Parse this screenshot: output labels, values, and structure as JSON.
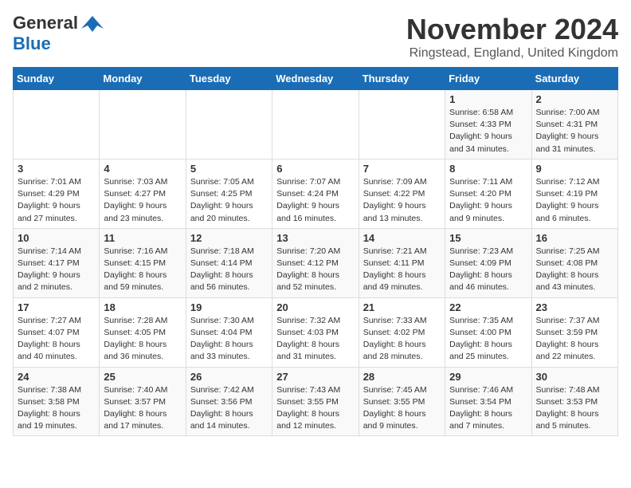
{
  "logo": {
    "text_general": "General",
    "text_blue": "Blue"
  },
  "header": {
    "month": "November 2024",
    "location": "Ringstead, England, United Kingdom"
  },
  "days_of_week": [
    "Sunday",
    "Monday",
    "Tuesday",
    "Wednesday",
    "Thursday",
    "Friday",
    "Saturday"
  ],
  "weeks": [
    [
      {
        "day": "",
        "info": ""
      },
      {
        "day": "",
        "info": ""
      },
      {
        "day": "",
        "info": ""
      },
      {
        "day": "",
        "info": ""
      },
      {
        "day": "",
        "info": ""
      },
      {
        "day": "1",
        "info": "Sunrise: 6:58 AM\nSunset: 4:33 PM\nDaylight: 9 hours and 34 minutes."
      },
      {
        "day": "2",
        "info": "Sunrise: 7:00 AM\nSunset: 4:31 PM\nDaylight: 9 hours and 31 minutes."
      }
    ],
    [
      {
        "day": "3",
        "info": "Sunrise: 7:01 AM\nSunset: 4:29 PM\nDaylight: 9 hours and 27 minutes."
      },
      {
        "day": "4",
        "info": "Sunrise: 7:03 AM\nSunset: 4:27 PM\nDaylight: 9 hours and 23 minutes."
      },
      {
        "day": "5",
        "info": "Sunrise: 7:05 AM\nSunset: 4:25 PM\nDaylight: 9 hours and 20 minutes."
      },
      {
        "day": "6",
        "info": "Sunrise: 7:07 AM\nSunset: 4:24 PM\nDaylight: 9 hours and 16 minutes."
      },
      {
        "day": "7",
        "info": "Sunrise: 7:09 AM\nSunset: 4:22 PM\nDaylight: 9 hours and 13 minutes."
      },
      {
        "day": "8",
        "info": "Sunrise: 7:11 AM\nSunset: 4:20 PM\nDaylight: 9 hours and 9 minutes."
      },
      {
        "day": "9",
        "info": "Sunrise: 7:12 AM\nSunset: 4:19 PM\nDaylight: 9 hours and 6 minutes."
      }
    ],
    [
      {
        "day": "10",
        "info": "Sunrise: 7:14 AM\nSunset: 4:17 PM\nDaylight: 9 hours and 2 minutes."
      },
      {
        "day": "11",
        "info": "Sunrise: 7:16 AM\nSunset: 4:15 PM\nDaylight: 8 hours and 59 minutes."
      },
      {
        "day": "12",
        "info": "Sunrise: 7:18 AM\nSunset: 4:14 PM\nDaylight: 8 hours and 56 minutes."
      },
      {
        "day": "13",
        "info": "Sunrise: 7:20 AM\nSunset: 4:12 PM\nDaylight: 8 hours and 52 minutes."
      },
      {
        "day": "14",
        "info": "Sunrise: 7:21 AM\nSunset: 4:11 PM\nDaylight: 8 hours and 49 minutes."
      },
      {
        "day": "15",
        "info": "Sunrise: 7:23 AM\nSunset: 4:09 PM\nDaylight: 8 hours and 46 minutes."
      },
      {
        "day": "16",
        "info": "Sunrise: 7:25 AM\nSunset: 4:08 PM\nDaylight: 8 hours and 43 minutes."
      }
    ],
    [
      {
        "day": "17",
        "info": "Sunrise: 7:27 AM\nSunset: 4:07 PM\nDaylight: 8 hours and 40 minutes."
      },
      {
        "day": "18",
        "info": "Sunrise: 7:28 AM\nSunset: 4:05 PM\nDaylight: 8 hours and 36 minutes."
      },
      {
        "day": "19",
        "info": "Sunrise: 7:30 AM\nSunset: 4:04 PM\nDaylight: 8 hours and 33 minutes."
      },
      {
        "day": "20",
        "info": "Sunrise: 7:32 AM\nSunset: 4:03 PM\nDaylight: 8 hours and 31 minutes."
      },
      {
        "day": "21",
        "info": "Sunrise: 7:33 AM\nSunset: 4:02 PM\nDaylight: 8 hours and 28 minutes."
      },
      {
        "day": "22",
        "info": "Sunrise: 7:35 AM\nSunset: 4:00 PM\nDaylight: 8 hours and 25 minutes."
      },
      {
        "day": "23",
        "info": "Sunrise: 7:37 AM\nSunset: 3:59 PM\nDaylight: 8 hours and 22 minutes."
      }
    ],
    [
      {
        "day": "24",
        "info": "Sunrise: 7:38 AM\nSunset: 3:58 PM\nDaylight: 8 hours and 19 minutes."
      },
      {
        "day": "25",
        "info": "Sunrise: 7:40 AM\nSunset: 3:57 PM\nDaylight: 8 hours and 17 minutes."
      },
      {
        "day": "26",
        "info": "Sunrise: 7:42 AM\nSunset: 3:56 PM\nDaylight: 8 hours and 14 minutes."
      },
      {
        "day": "27",
        "info": "Sunrise: 7:43 AM\nSunset: 3:55 PM\nDaylight: 8 hours and 12 minutes."
      },
      {
        "day": "28",
        "info": "Sunrise: 7:45 AM\nSunset: 3:55 PM\nDaylight: 8 hours and 9 minutes."
      },
      {
        "day": "29",
        "info": "Sunrise: 7:46 AM\nSunset: 3:54 PM\nDaylight: 8 hours and 7 minutes."
      },
      {
        "day": "30",
        "info": "Sunrise: 7:48 AM\nSunset: 3:53 PM\nDaylight: 8 hours and 5 minutes."
      }
    ]
  ]
}
